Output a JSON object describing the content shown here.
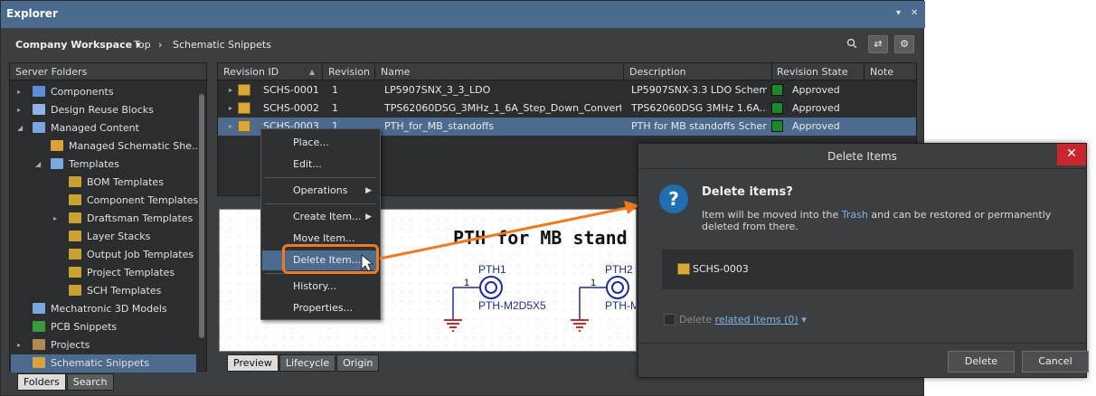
{
  "window": {
    "title": "Explorer"
  },
  "toolbar": {
    "workspace": "Company Workspace",
    "crumb_top": "Top",
    "crumb_sep": "›",
    "crumb_folder": "Schematic Snippets"
  },
  "left_panel": {
    "header": "Server Folders",
    "items": [
      {
        "label": "Components",
        "expander": "▸"
      },
      {
        "label": "Design Reuse Blocks",
        "expander": "▸"
      },
      {
        "label": "Managed Content",
        "expander": "◢"
      },
      {
        "label": "Managed Schematic She...",
        "expander": ""
      },
      {
        "label": "Templates",
        "expander": "◢"
      },
      {
        "label": "BOM Templates",
        "expander": ""
      },
      {
        "label": "Component Templates",
        "expander": ""
      },
      {
        "label": "Draftsman Templates",
        "expander": "▸"
      },
      {
        "label": "Layer Stacks",
        "expander": ""
      },
      {
        "label": "Output Job Templates",
        "expander": ""
      },
      {
        "label": "Project Templates",
        "expander": ""
      },
      {
        "label": "SCH Templates",
        "expander": ""
      },
      {
        "label": "Mechatronic 3D Models",
        "expander": ""
      },
      {
        "label": "PCB Snippets",
        "expander": ""
      },
      {
        "label": "Projects",
        "expander": "▸"
      },
      {
        "label": "Schematic Snippets",
        "expander": ""
      }
    ],
    "tabs": [
      "Folders",
      "Search"
    ]
  },
  "grid": {
    "columns": [
      "Revision ID",
      "Revision",
      "Name",
      "Description",
      "Revision State",
      "Note"
    ],
    "rows": [
      {
        "id": "SCHS-0001",
        "rev": "1",
        "name": "LP5907SNX_3_3_LDO",
        "desc": "LP5907SNX-3.3 LDO Schem...",
        "state": "Approved"
      },
      {
        "id": "SCHS-0002",
        "rev": "1",
        "name": "TPS62060DSG_3MHz_1_6A_Step_Down_Converter",
        "desc": "TPS62060DSG 3MHz 1.6A...",
        "state": "Approved"
      },
      {
        "id": "SCHS-0003",
        "rev": "1",
        "name": "PTH_for_MB_standoffs",
        "desc": "PTH for MB standoffs Schem...",
        "state": "Approved"
      }
    ]
  },
  "preview": {
    "title": "PTH for MB stand",
    "parts": [
      {
        "ref": "PTH1",
        "pin": "1",
        "value": "PTH-M2D5X5"
      },
      {
        "ref": "PTH2",
        "pin": "1",
        "value": "PTH-M"
      }
    ],
    "tabs": [
      "Preview",
      "Lifecycle",
      "Origin"
    ]
  },
  "context_menu": [
    "Place...",
    "Edit...",
    "Operations",
    "Create Item...",
    "Move Item...",
    "Delete Item...",
    "History...",
    "Properties..."
  ],
  "dialog": {
    "title": "Delete Items",
    "close": "✕",
    "heading": "Delete items?",
    "msg_pre": "Item will be moved into the",
    "msg_link": "Trash",
    "msg_post": "and can be restored or permanently deleted from there.",
    "item": "SCHS-0003",
    "related_prefix": "Delete",
    "related_link": "related items (0)",
    "buttons": {
      "delete": "Delete",
      "cancel": "Cancel"
    }
  },
  "colors": {
    "accent": "#f07b1e",
    "selection": "#4d6b8f",
    "approved": "#1b8a2a"
  }
}
